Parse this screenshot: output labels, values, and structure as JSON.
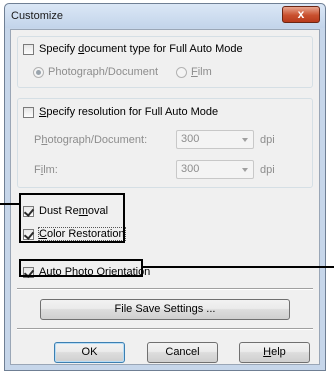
{
  "window": {
    "title": "Customize",
    "close_glyph": "x"
  },
  "doc_type": {
    "checkbox_label_pre": "Specify ",
    "checkbox_label_ul": "d",
    "checkbox_label_post": "ocument type for Full Auto Mode",
    "checked": false,
    "radio_photo_label": "Photograph/Document",
    "radio_film_pre": "",
    "radio_film_ul": "F",
    "radio_film_post": "ilm",
    "selected": "Photograph/Document"
  },
  "resolution": {
    "checkbox_label_pre": "",
    "checkbox_label_ul": "S",
    "checkbox_label_post": "pecify resolution for Full Auto Mode",
    "checked": false,
    "photo_label_pre": "P",
    "photo_label_ul": "h",
    "photo_label_post": "otograph/Document:",
    "photo_value": "300",
    "photo_unit": "dpi",
    "film_label_pre": "F",
    "film_label_ul": "i",
    "film_label_post": "lm:",
    "film_value": "300",
    "film_unit": "dpi"
  },
  "options": {
    "dust_pre": "Dust Re",
    "dust_ul": "m",
    "dust_post": "oval",
    "dust_checked": true,
    "color_pre": "",
    "color_ul": "C",
    "color_post": "olor Restoration",
    "color_checked": true,
    "auto_pre": "",
    "auto_ul": "A",
    "auto_post": "uto Photo Orientation",
    "auto_checked": true
  },
  "buttons": {
    "file_save_label": "File Save Settings ...",
    "ok_label": "OK",
    "cancel_label": "Cancel",
    "help_pre": "",
    "help_ul": "H",
    "help_post": "elp"
  },
  "colors": {
    "titlebar": "#c3d4ea",
    "close": "#c9502e",
    "callout": "#000000"
  }
}
